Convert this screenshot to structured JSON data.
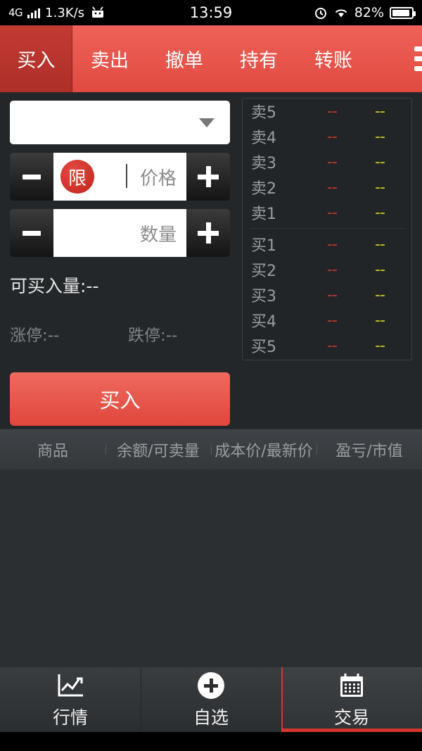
{
  "status_bar": {
    "network": "4G",
    "speed": "1.3K/s",
    "android_icon": "android-robot-icon",
    "time": "13:59",
    "alarm_icon": "alarm-clock-icon",
    "wifi_icon": "wifi-icon",
    "battery_percent": "82%"
  },
  "top_nav": {
    "tabs": [
      {
        "label": "买入",
        "active": true
      },
      {
        "label": "卖出",
        "active": false
      },
      {
        "label": "撤单",
        "active": false
      },
      {
        "label": "持有",
        "active": false
      },
      {
        "label": "转账",
        "active": false
      }
    ],
    "menu_icon": "hamburger-menu-icon"
  },
  "order_form": {
    "symbol_value": "",
    "symbol_placeholder": "",
    "dropdown_icon": "chevron-down-icon",
    "price": {
      "badge": "限",
      "value": "",
      "placeholder": "价格",
      "minus_label": "−",
      "plus_label": "+"
    },
    "quantity": {
      "value": "",
      "placeholder": "数量",
      "minus_label": "−",
      "plus_label": "+"
    },
    "available_label": "可买入量:--",
    "upper_limit": "涨停:--",
    "lower_limit": "跌停:--",
    "submit_label": "买入"
  },
  "order_book": {
    "rows": [
      {
        "label": "卖5",
        "price": "--",
        "volume": "--"
      },
      {
        "label": "卖4",
        "price": "--",
        "volume": "--"
      },
      {
        "label": "卖3",
        "price": "--",
        "volume": "--"
      },
      {
        "label": "卖2",
        "price": "--",
        "volume": "--"
      },
      {
        "label": "卖1",
        "price": "--",
        "volume": "--"
      },
      {
        "label": "买1",
        "price": "--",
        "volume": "--"
      },
      {
        "label": "买2",
        "price": "--",
        "volume": "--"
      },
      {
        "label": "买3",
        "price": "--",
        "volume": "--"
      },
      {
        "label": "买4",
        "price": "--",
        "volume": "--"
      },
      {
        "label": "买5",
        "price": "--",
        "volume": "--"
      }
    ],
    "ask_color": "#c0392b",
    "volume_color": "#c9c91e"
  },
  "positions_table": {
    "headers": [
      "商品",
      "余额/可卖量",
      "成本价/最新价",
      "盈亏/市值"
    ],
    "rows": []
  },
  "bottom_nav": {
    "items": [
      {
        "label": "行情",
        "icon": "line-chart-icon",
        "active": false
      },
      {
        "label": "自选",
        "icon": "plus-circle-icon",
        "active": false
      },
      {
        "label": "交易",
        "icon": "calendar-icon",
        "active": true
      }
    ]
  },
  "colors": {
    "brand_red": "#e04a40",
    "active_tab_red": "#c23b33",
    "background": "#23272a",
    "accent": "#d0382f"
  }
}
